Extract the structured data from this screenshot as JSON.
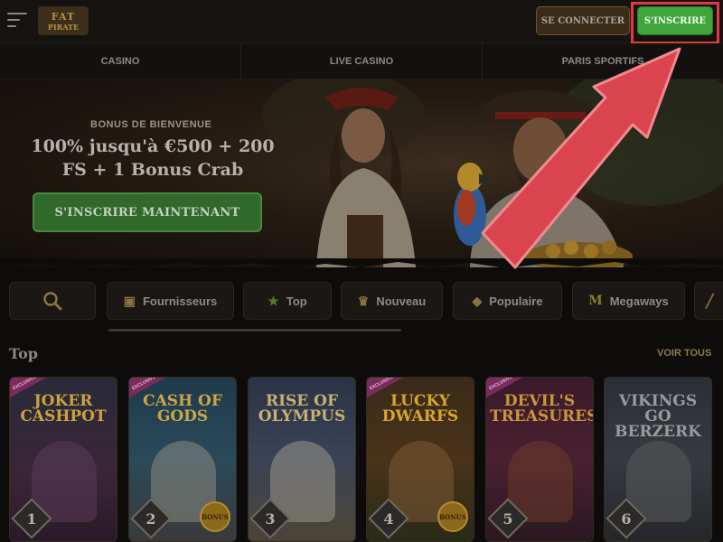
{
  "header": {
    "logo_line1": "FAT",
    "logo_line2": "PIRATE",
    "login_label": "SE CONNECTER",
    "signup_label": "S'INSCRIRE"
  },
  "nav": {
    "items": [
      "CASINO",
      "LIVE CASINO",
      "PARIS SPORTIFS"
    ]
  },
  "hero": {
    "eyebrow": "BONUS DE BIENVENUE",
    "title": "100% jusqu'à €500 + 200 FS + 1 Bonus Crab",
    "cta_label": "S'INSCRIRE MAINTENANT"
  },
  "filters": {
    "search_icon": "search-icon",
    "chips": [
      {
        "label": "Fournisseurs",
        "icon": "map-icon"
      },
      {
        "label": "Top",
        "icon": "star-icon"
      },
      {
        "label": "Nouveau",
        "icon": "trophy-icon"
      },
      {
        "label": "Populaire",
        "icon": "gem-icon"
      },
      {
        "label": "Megaways",
        "icon": "megaways-icon"
      }
    ]
  },
  "top_section": {
    "title": "Top",
    "see_all_label": "VOIR TOUS",
    "games": [
      {
        "rank": "1",
        "title": "JOKER CASHPOT",
        "badge": "EXCLUSIVE",
        "bonus": ""
      },
      {
        "rank": "2",
        "title": "CASH OF GODS",
        "badge": "EXCLUSIVE",
        "bonus": "BONUS"
      },
      {
        "rank": "3",
        "title": "RISE OF OLYMPUS",
        "badge": "",
        "bonus": ""
      },
      {
        "rank": "4",
        "title": "LUCKY DWARFS",
        "badge": "EXCLUSIVE",
        "bonus": "BONUS"
      },
      {
        "rank": "5",
        "title": "DEVIL'S TREASURES",
        "badge": "EXCLUSIVE",
        "bonus": ""
      },
      {
        "rank": "6",
        "title": "VIKINGS GO BERZERK",
        "badge": "",
        "bonus": ""
      }
    ]
  },
  "colors": {
    "accent_green": "#3fa53a",
    "highlight_red": "#e23a3f",
    "gold": "#b9923e"
  }
}
